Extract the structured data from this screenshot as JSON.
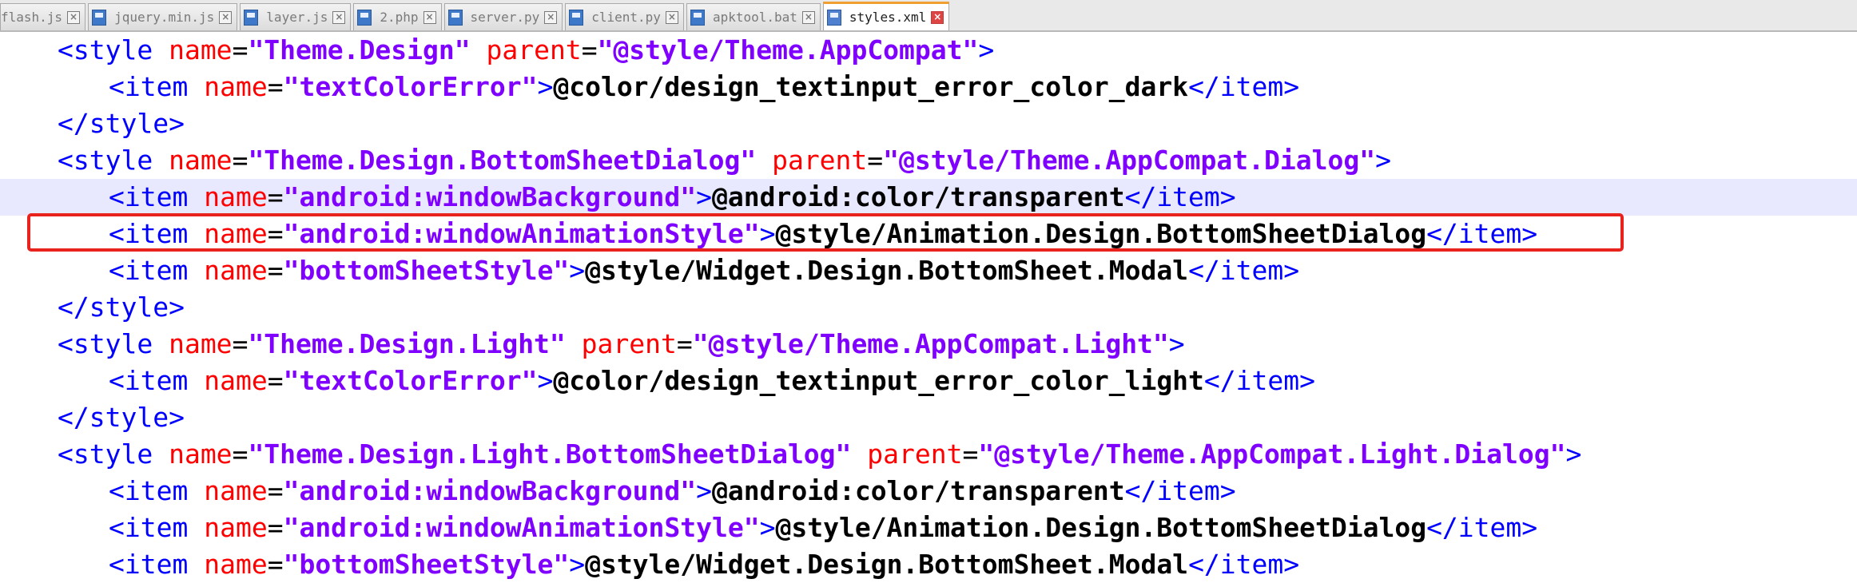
{
  "tabs": [
    {
      "label": "flash.js",
      "active": false
    },
    {
      "label": "jquery.min.js",
      "active": false
    },
    {
      "label": "layer.js",
      "active": false
    },
    {
      "label": "2.php",
      "active": false
    },
    {
      "label": "server.py",
      "active": false
    },
    {
      "label": "client.py",
      "active": false
    },
    {
      "label": "apktool.bat",
      "active": false
    },
    {
      "label": "styles.xml",
      "active": true
    }
  ],
  "code_lines": [
    {
      "indent": 1,
      "segments": [
        [
          "tag",
          "<style "
        ],
        [
          "attr",
          "name"
        ],
        [
          "eq",
          "="
        ],
        [
          "val",
          "\"Theme.Design\""
        ],
        [
          "eq",
          " "
        ],
        [
          "attr",
          "parent"
        ],
        [
          "eq",
          "="
        ],
        [
          "val",
          "\"@style/Theme.AppCompat\""
        ],
        [
          "tag",
          ">"
        ]
      ]
    },
    {
      "indent": 2,
      "segments": [
        [
          "tag",
          "<item "
        ],
        [
          "attr",
          "name"
        ],
        [
          "eq",
          "="
        ],
        [
          "val",
          "\"textColorError\""
        ],
        [
          "tag",
          ">"
        ],
        [
          "txt",
          "@color/design_textinput_error_color_dark"
        ],
        [
          "tag",
          "</item>"
        ]
      ]
    },
    {
      "indent": 1,
      "segments": [
        [
          "tag",
          "</style>"
        ]
      ]
    },
    {
      "indent": 1,
      "segments": [
        [
          "tag",
          "<style "
        ],
        [
          "attr",
          "name"
        ],
        [
          "eq",
          "="
        ],
        [
          "val",
          "\"Theme.Design.BottomSheetDialog\""
        ],
        [
          "eq",
          " "
        ],
        [
          "attr",
          "parent"
        ],
        [
          "eq",
          "="
        ],
        [
          "val",
          "\"@style/Theme.AppCompat.Dialog\""
        ],
        [
          "tag",
          ">"
        ]
      ]
    },
    {
      "indent": 2,
      "current": true,
      "segments": [
        [
          "tag",
          "<item "
        ],
        [
          "attr",
          "name"
        ],
        [
          "eq",
          "="
        ],
        [
          "val",
          "\"android:windowBackground\""
        ],
        [
          "tag",
          ">"
        ],
        [
          "txt",
          "@android:color/transparent"
        ],
        [
          "tag",
          "</item>"
        ]
      ]
    },
    {
      "indent": 2,
      "segments": [
        [
          "tag",
          "<item "
        ],
        [
          "attr",
          "name"
        ],
        [
          "eq",
          "="
        ],
        [
          "val",
          "\"android:windowAnimationStyle\""
        ],
        [
          "tag",
          ">"
        ],
        [
          "txt",
          "@style/Animation.Design.BottomSheetDialog"
        ],
        [
          "tag",
          "</item>"
        ]
      ]
    },
    {
      "indent": 2,
      "segments": [
        [
          "tag",
          "<item "
        ],
        [
          "attr",
          "name"
        ],
        [
          "eq",
          "="
        ],
        [
          "val",
          "\"bottomSheetStyle\""
        ],
        [
          "tag",
          ">"
        ],
        [
          "txt",
          "@style/Widget.Design.BottomSheet.Modal"
        ],
        [
          "tag",
          "</item>"
        ]
      ]
    },
    {
      "indent": 1,
      "segments": [
        [
          "tag",
          "</style>"
        ]
      ]
    },
    {
      "indent": 1,
      "segments": [
        [
          "tag",
          "<style "
        ],
        [
          "attr",
          "name"
        ],
        [
          "eq",
          "="
        ],
        [
          "val",
          "\"Theme.Design.Light\""
        ],
        [
          "eq",
          " "
        ],
        [
          "attr",
          "parent"
        ],
        [
          "eq",
          "="
        ],
        [
          "val",
          "\"@style/Theme.AppCompat.Light\""
        ],
        [
          "tag",
          ">"
        ]
      ]
    },
    {
      "indent": 2,
      "segments": [
        [
          "tag",
          "<item "
        ],
        [
          "attr",
          "name"
        ],
        [
          "eq",
          "="
        ],
        [
          "val",
          "\"textColorError\""
        ],
        [
          "tag",
          ">"
        ],
        [
          "txt",
          "@color/design_textinput_error_color_light"
        ],
        [
          "tag",
          "</item>"
        ]
      ]
    },
    {
      "indent": 1,
      "segments": [
        [
          "tag",
          "</style>"
        ]
      ]
    },
    {
      "indent": 1,
      "segments": [
        [
          "tag",
          "<style "
        ],
        [
          "attr",
          "name"
        ],
        [
          "eq",
          "="
        ],
        [
          "val",
          "\"Theme.Design.Light.BottomSheetDialog\""
        ],
        [
          "eq",
          " "
        ],
        [
          "attr",
          "parent"
        ],
        [
          "eq",
          "="
        ],
        [
          "val",
          "\"@style/Theme.AppCompat.Light.Dialog\""
        ],
        [
          "tag",
          ">"
        ]
      ]
    },
    {
      "indent": 2,
      "segments": [
        [
          "tag",
          "<item "
        ],
        [
          "attr",
          "name"
        ],
        [
          "eq",
          "="
        ],
        [
          "val",
          "\"android:windowBackground\""
        ],
        [
          "tag",
          ">"
        ],
        [
          "txt",
          "@android:color/transparent"
        ],
        [
          "tag",
          "</item>"
        ]
      ]
    },
    {
      "indent": 2,
      "segments": [
        [
          "tag",
          "<item "
        ],
        [
          "attr",
          "name"
        ],
        [
          "eq",
          "="
        ],
        [
          "val",
          "\"android:windowAnimationStyle\""
        ],
        [
          "tag",
          ">"
        ],
        [
          "txt",
          "@style/Animation.Design.BottomSheetDialog"
        ],
        [
          "tag",
          "</item>"
        ]
      ]
    },
    {
      "indent": 2,
      "segments": [
        [
          "tag",
          "<item "
        ],
        [
          "attr",
          "name"
        ],
        [
          "eq",
          "="
        ],
        [
          "val",
          "\"bottomSheetStyle\""
        ],
        [
          "tag",
          ">"
        ],
        [
          "txt",
          "@style/Widget.Design.BottomSheet.Modal"
        ],
        [
          "tag",
          "</item>"
        ]
      ]
    }
  ],
  "colors": {
    "tag": "#0000ff",
    "attribute": "#ff0000",
    "value": "#8000ff",
    "text": "#000000",
    "current_line": "#e8e8ff",
    "annotation_box": "#e8231e"
  }
}
